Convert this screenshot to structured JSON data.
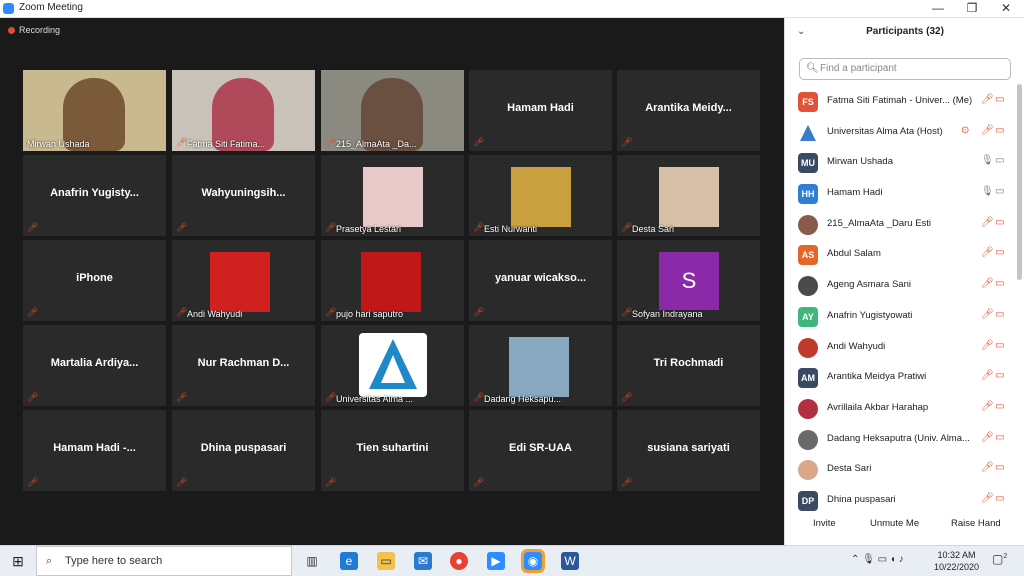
{
  "window": {
    "title": "Zoom Meeting",
    "minimize": "—",
    "maximize": "❐",
    "close": "✕"
  },
  "recording": {
    "label": "Recording"
  },
  "tiles": [
    {
      "label": "Mirwan Ushada",
      "kind": "video",
      "active": true
    },
    {
      "label": "Fatma Siti Fatima...",
      "kind": "video"
    },
    {
      "label": "215_AlmaAta _Da...",
      "kind": "video"
    },
    {
      "name": "Hamam Hadi",
      "kind": "name"
    },
    {
      "name": "Arantika  Meidy...",
      "kind": "name"
    },
    {
      "name": "Anafrin  Yugisty...",
      "kind": "name"
    },
    {
      "name": "Wahyuningsih...",
      "kind": "name"
    },
    {
      "label": "Prasetya Lestari",
      "kind": "photo"
    },
    {
      "label": "Esti Nurwanti",
      "kind": "photo"
    },
    {
      "label": "Desta Sari",
      "kind": "photo"
    },
    {
      "name": "iPhone",
      "kind": "name"
    },
    {
      "label": "Andi Wahyudi",
      "kind": "photo"
    },
    {
      "label": "pujo hari saputro",
      "kind": "photo"
    },
    {
      "name": "yanuar  wicakso...",
      "kind": "name"
    },
    {
      "label": "Sofyan Indrayana",
      "kind": "letter",
      "letter": "S"
    },
    {
      "name": "Martalia  Ardiya...",
      "kind": "name"
    },
    {
      "name": "Nur Rachman D...",
      "kind": "name"
    },
    {
      "label": "Universitas Alma ...",
      "kind": "logo"
    },
    {
      "label": "Dadang Heksapu...",
      "kind": "photo"
    },
    {
      "name": "Tri Rochmadi",
      "kind": "name"
    },
    {
      "name": "Hamam  Hadi  -...",
      "kind": "name"
    },
    {
      "name": "Dhina puspasari",
      "kind": "name"
    },
    {
      "name": "Tien suhartini",
      "kind": "name"
    },
    {
      "name": "Edi SR-UAA",
      "kind": "name"
    },
    {
      "name": "susiana sariyati",
      "kind": "name"
    }
  ],
  "participants_panel": {
    "title": "Participants (32)",
    "search_placeholder": "Find a participant",
    "participants": [
      {
        "initials": "FS",
        "name": "Fatma Siti Fatimah - Univer... (Me)",
        "color": "#e0533a",
        "avatar": "initials"
      },
      {
        "initials": "",
        "name": "Universitas Alma Ata (Host)",
        "color": "#3b7cc9",
        "avatar": "logo"
      },
      {
        "initials": "MU",
        "name": "Mirwan Ushada",
        "color": "#3b4a63",
        "avatar": "initials"
      },
      {
        "initials": "HH",
        "name": "Hamam Hadi",
        "color": "#2f7fd6",
        "avatar": "initials"
      },
      {
        "initials": "",
        "name": "215_AlmaAta _Daru Esti",
        "color": "#8a5a4a",
        "avatar": "photo"
      },
      {
        "initials": "AS",
        "name": "Abdul Salam",
        "color": "#e5662a",
        "avatar": "initials"
      },
      {
        "initials": "",
        "name": "Ageng Asmara Sani",
        "color": "#4a4a4a",
        "avatar": "photo"
      },
      {
        "initials": "AY",
        "name": "Anafrin Yugistyowati",
        "color": "#3fb67a",
        "avatar": "initials"
      },
      {
        "initials": "",
        "name": "Andi Wahyudi",
        "color": "#c0392b",
        "avatar": "photo"
      },
      {
        "initials": "AM",
        "name": "Arantika Meidya Pratiwi",
        "color": "#3b4a63",
        "avatar": "initials"
      },
      {
        "initials": "",
        "name": "Avrillaila Akbar Harahap",
        "color": "#b03040",
        "avatar": "photo"
      },
      {
        "initials": "",
        "name": "Dadang Heksaputra (Univ. Alma...",
        "color": "#6a6a6a",
        "avatar": "photo"
      },
      {
        "initials": "",
        "name": "Desta Sari",
        "color": "#d9a88a",
        "avatar": "photo"
      },
      {
        "initials": "DP",
        "name": "Dhina puspasari",
        "color": "#3b4a63",
        "avatar": "initials"
      }
    ],
    "buttons": {
      "invite": "Invite",
      "unmute": "Unmute Me",
      "raise_hand": "Raise Hand"
    }
  },
  "taskbar": {
    "search_placeholder": "Type here to search",
    "time": "10:32 AM",
    "date": "10/22/2020",
    "notifications": "2"
  }
}
